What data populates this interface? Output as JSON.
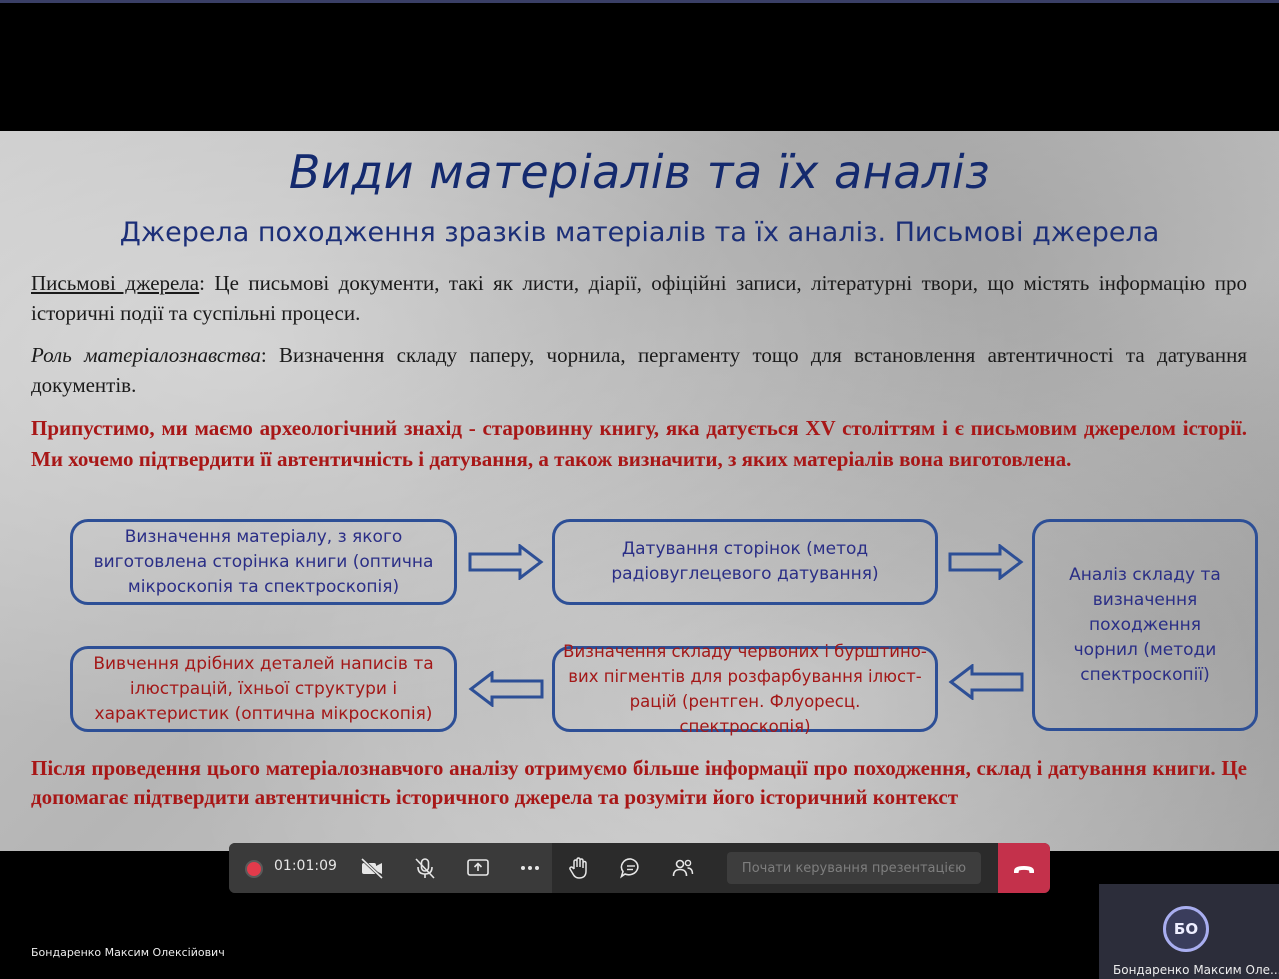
{
  "slide": {
    "title": "Види матеріалів та їх аналіз",
    "subtitle": "Джерела походження зразків матеріалів та їх аналіз. Письмові джерела",
    "para1": {
      "lead": "Письмові джерела",
      "text": ": Це письмові документи, такі як листи, діарії, офіційні записи, літературні твори, що містять інформацію про історичні події та суспільні процеси."
    },
    "para2": {
      "lead": "Роль матеріалознавства",
      "text": ": Визначення складу паперу, чорнила, пергаменту тощо для встановлення автентичності та датування документів."
    },
    "red_intro": "Припустимо, ми маємо археологічний знахід - старовинну книгу, яка датується XV століттям і є письмовим джерелом історії. Ми хочемо підтвердити її автентичність і датування, а також визначити, з яких матеріалів вона виготовлена.",
    "boxes": {
      "b1": [
        "Визначення матеріалу, з якого",
        "виготовлена сторінка книги (оптична",
        "мікроскопія та спектроскопія)"
      ],
      "b2": [
        "Датування сторінок (метод",
        "радіовуглецевого датування)"
      ],
      "b3": [
        "Аналіз складу та",
        "визначення",
        "походження",
        "чорнил (методи",
        "спектроскопії)"
      ],
      "b4": [
        "Визначення складу червоних і бурштино-",
        "вих пігментів для розфарбування ілюст-",
        "рацій (рентген. Флуоресц. спектроскопія)"
      ],
      "b5": [
        "Вивчення  дрібних деталей написів та",
        "ілюстрацій, їхньої структури і",
        "характеристик (оптична мікроскопія)"
      ]
    },
    "red_conclusion": "Після проведення цього матеріалознавчого аналізу отримуємо більше інформації про походження, склад і датування книги. Це допомагає підтвердити автентичність історичного джерела та розуміти його історичний контекст"
  },
  "meeting": {
    "timer": "01:01:09",
    "present_button": "Почати керування презентацією",
    "presenter_name": "Бондаренко Максим Олексійович",
    "participant": {
      "initials": "БО",
      "name": "Бондаренко Максим Оле..."
    }
  },
  "colors": {
    "title_blue": "#142a6e",
    "box_border": "#2d4f96",
    "accent_red": "#a81717",
    "end_call_red": "#c4314b"
  },
  "icons": [
    "camera-off-icon",
    "mic-off-icon",
    "share-screen-icon",
    "more-icon",
    "raise-hand-icon",
    "chat-icon",
    "people-icon",
    "hang-up-icon"
  ]
}
